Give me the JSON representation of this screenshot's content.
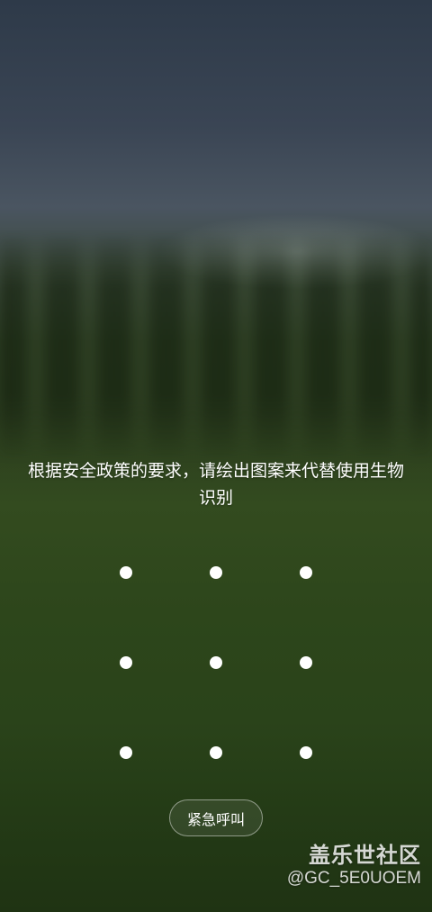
{
  "lock_screen": {
    "prompt_text": "根据安全政策的要求，请绘出图案来代替使用生物识别",
    "pattern": {
      "rows": 3,
      "cols": 3
    },
    "emergency_call_label": "紧急呼叫"
  },
  "watermark": {
    "logo_text": "盖乐世社区",
    "username": "@GC_5E0UOEM"
  }
}
